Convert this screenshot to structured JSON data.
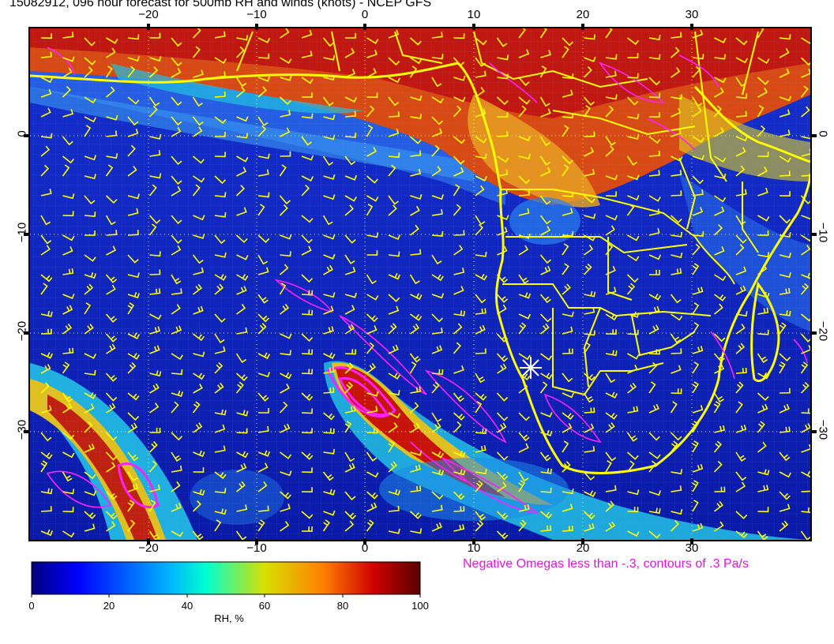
{
  "title": "15082912, 096 hour forecast for 500mb RH and winds (knots) - NCEP GFS",
  "map": {
    "longitude_ticks": [
      "−20",
      "−10",
      "0",
      "10",
      "20",
      "30"
    ],
    "latitude_ticks": [
      "0",
      "−10",
      "−20",
      "−30"
    ],
    "field": "500mb relative humidity",
    "overlays": [
      "wind barbs (knots)",
      "coastlines and borders",
      "negative omega contours"
    ],
    "colors": {
      "coast": "#ffff00",
      "barbs": "#ffff00",
      "omega": "#ff00ff",
      "grid": "#ffff88"
    }
  },
  "omega_note": "Negative Omegas less than -.3, contours of .3 Pa/s",
  "colorbar": {
    "labels": [
      "0",
      "20",
      "40",
      "60",
      "80",
      "100"
    ],
    "unit": "RH, %",
    "stops": [
      "#00007f",
      "#0000ff",
      "#00b0ff",
      "#00ffd0",
      "#d8e000",
      "#ff8000",
      "#d00000",
      "#5a0000"
    ]
  }
}
